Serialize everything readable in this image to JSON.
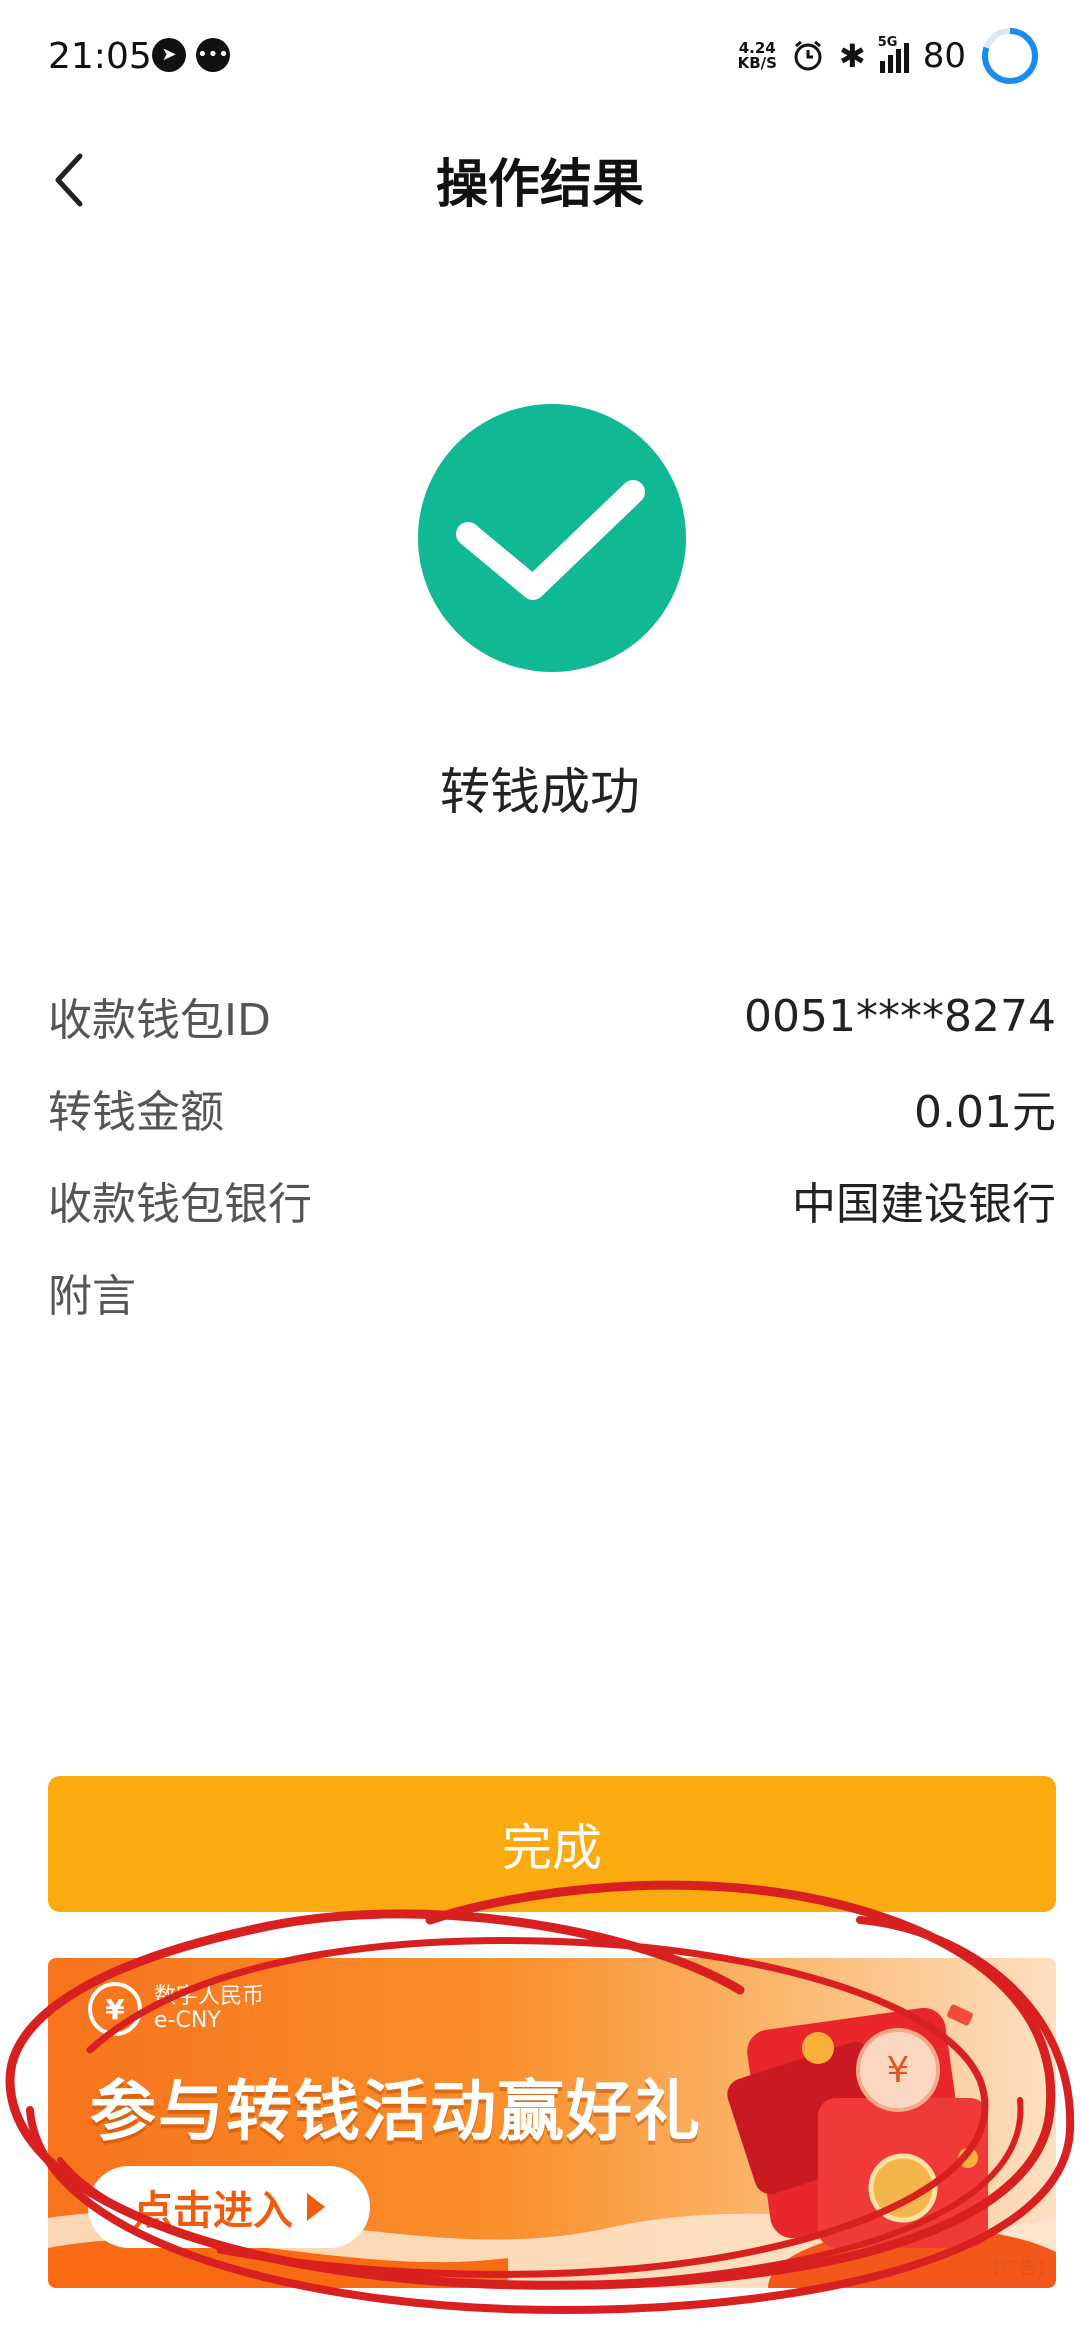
{
  "status_bar": {
    "time": "21:05",
    "net_speed_value": "4.24",
    "net_speed_unit": "KB/S",
    "network": "5G",
    "battery": "80",
    "icons": [
      "navigation-icon",
      "message-icon",
      "alarm-icon",
      "bluetooth-icon",
      "signal-icon",
      "battery-ring-icon"
    ]
  },
  "header": {
    "title": "操作结果",
    "back_icon": "chevron-left-icon"
  },
  "result": {
    "icon": "check-circle-icon",
    "status_text": "转钱成功",
    "accent_color": "#10b894"
  },
  "details": [
    {
      "label": "收款钱包ID",
      "value": "0051****8274"
    },
    {
      "label": "转钱金额",
      "value": "0.01元"
    },
    {
      "label": "收款钱包银行",
      "value": "中国建设银行"
    },
    {
      "label": "附言",
      "value": ""
    }
  ],
  "done_button": {
    "label": "完成",
    "color": "#fbaa0f"
  },
  "banner": {
    "brand_cn": "数字人民币",
    "brand_en": "e-CNY",
    "headline": "参与转钱活动赢好礼",
    "cta": "点击进入",
    "ad_tag": "[广告]",
    "illustration": "red-envelope-icon"
  },
  "annotation": {
    "color": "#d92020"
  }
}
